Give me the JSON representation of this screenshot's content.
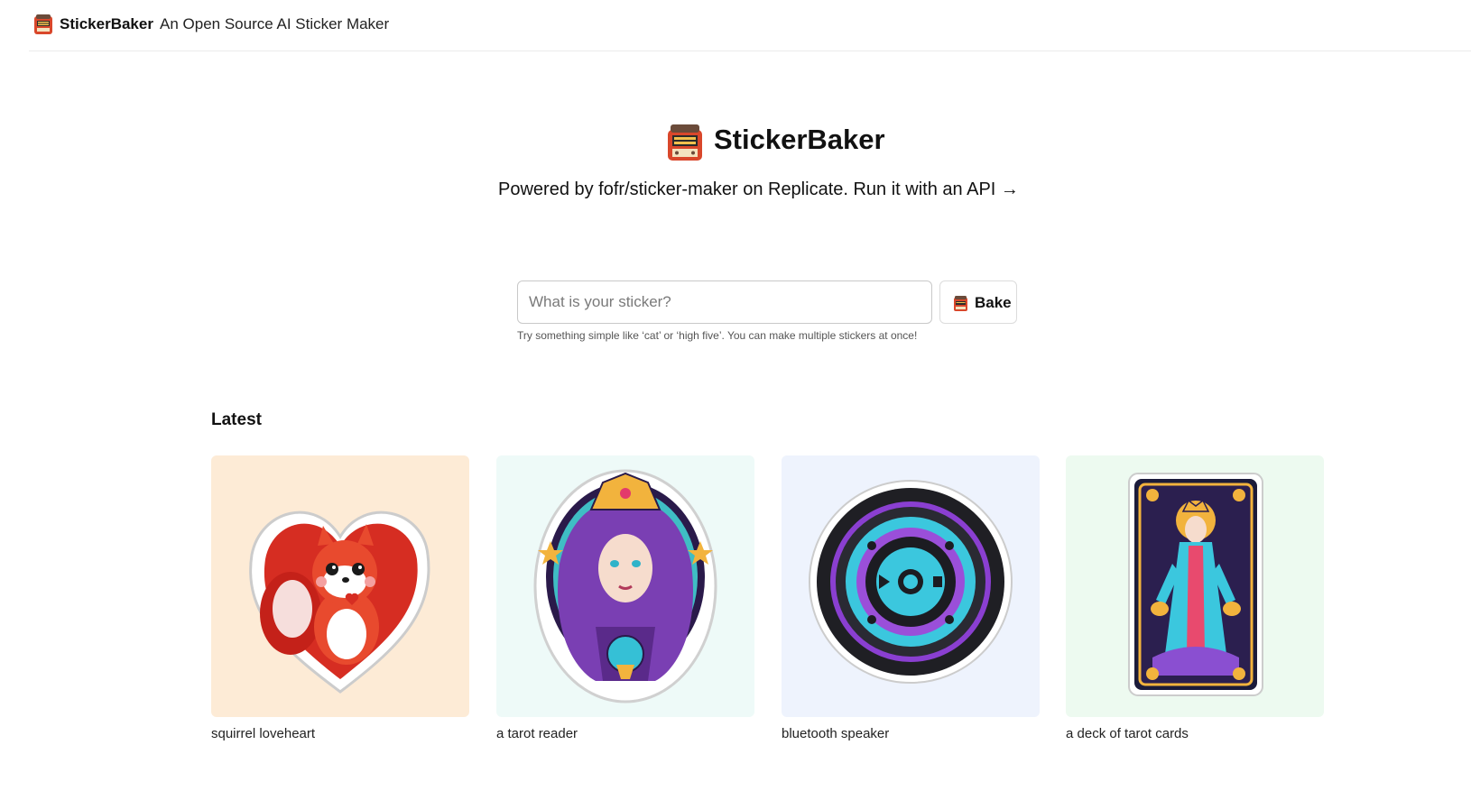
{
  "header": {
    "logo_icon": "toaster-oven-icon",
    "brand": "StickerBaker",
    "tagline": "An Open Source AI Sticker Maker"
  },
  "hero": {
    "logo_icon": "toaster-oven-icon",
    "title": "StickerBaker",
    "subtitle": "Powered by fofr/sticker-maker on Replicate. Run it with an API →"
  },
  "search": {
    "placeholder": "What is your sticker?",
    "value": "",
    "button_label": "Bake",
    "button_icon": "toaster-oven-icon",
    "hint": "Try something simple like ‘cat’ or ‘high five’. You can make multiple stickers at once!"
  },
  "latest": {
    "heading": "Latest",
    "items": [
      {
        "caption": "squirrel loveheart",
        "image": "squirrel-heart-sticker",
        "bg": "#fdebd6"
      },
      {
        "caption": "a tarot reader",
        "image": "tarot-reader-sticker",
        "bg": "#eefaf8"
      },
      {
        "caption": "bluetooth speaker",
        "image": "bluetooth-speaker-sticker",
        "bg": "#eef3fd"
      },
      {
        "caption": "a deck of tarot cards",
        "image": "tarot-card-deck-sticker",
        "bg": "#edfaf0"
      }
    ]
  }
}
